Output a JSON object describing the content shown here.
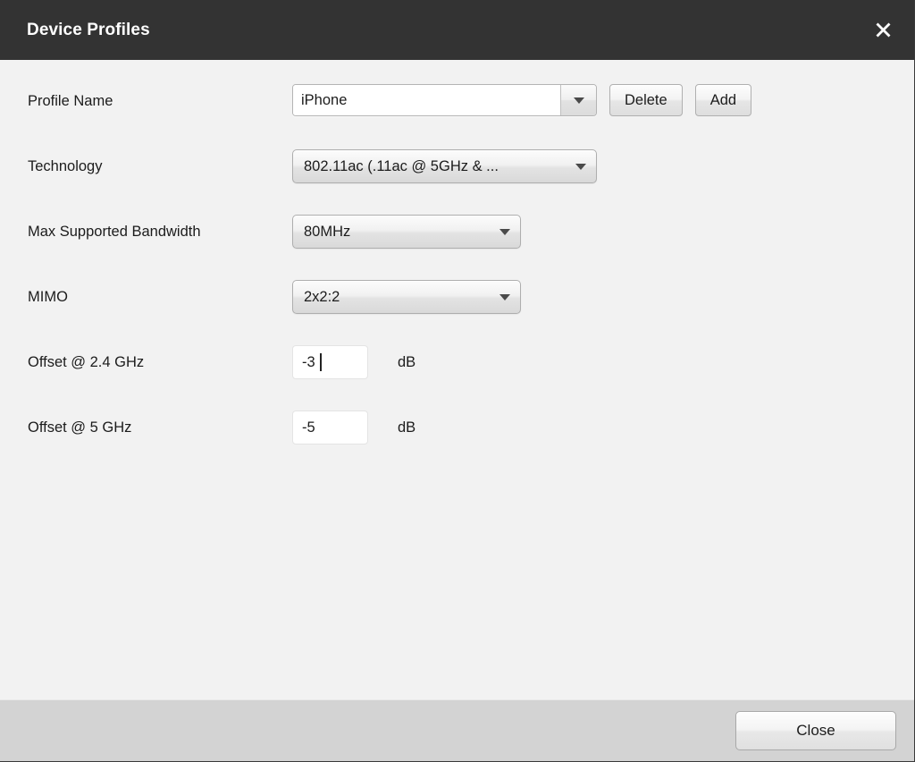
{
  "dialog": {
    "title": "Device Profiles",
    "close_icon": "close-icon"
  },
  "form": {
    "profile_name": {
      "label": "Profile Name",
      "value": "iPhone",
      "placeholder": "",
      "dropdown_icon": "chevron-down-icon",
      "delete_label": "Delete",
      "add_label": "Add"
    },
    "technology": {
      "label": "Technology",
      "value": "802.11ac (.11ac @ 5GHz & ...",
      "dropdown_icon": "chevron-down-icon"
    },
    "max_bandwidth": {
      "label": "Max Supported Bandwidth",
      "value": "80MHz",
      "dropdown_icon": "chevron-down-icon"
    },
    "mimo": {
      "label": "MIMO",
      "value": "2x2:2",
      "dropdown_icon": "chevron-down-icon"
    },
    "offset_24": {
      "label": "Offset @ 2.4 GHz",
      "value": "-3",
      "unit": "dB",
      "focused": true
    },
    "offset_5": {
      "label": "Offset @ 5 GHz",
      "value": "-5",
      "unit": "dB",
      "focused": false
    }
  },
  "footer": {
    "close_label": "Close"
  },
  "colors": {
    "titlebar_bg": "#333333",
    "body_bg": "#f2f2f2",
    "footer_bg": "#d3d3d3",
    "text": "#1c1c1c",
    "title_text": "#ffffff"
  }
}
